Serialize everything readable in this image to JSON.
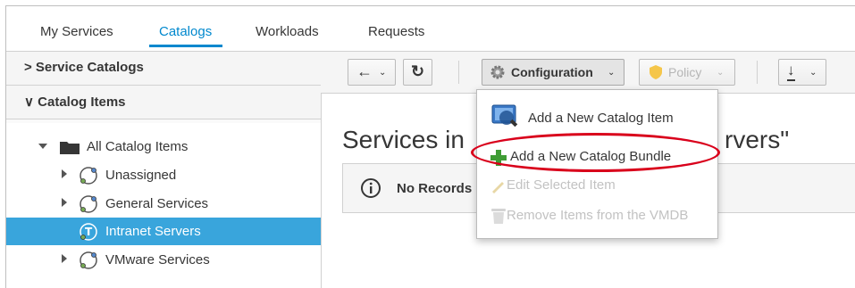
{
  "tabs": [
    {
      "label": "My Services"
    },
    {
      "label": "Catalogs"
    },
    {
      "label": "Workloads"
    },
    {
      "label": "Requests"
    }
  ],
  "sidebar": {
    "accordions": [
      {
        "label": "> Service Catalogs"
      },
      {
        "label": "∨ Catalog Items"
      }
    ],
    "tree": [
      {
        "label": "All Catalog Items"
      },
      {
        "label": "Unassigned"
      },
      {
        "label": "General Services"
      },
      {
        "label": "Intranet Servers"
      },
      {
        "label": "VMware Services"
      }
    ]
  },
  "toolbar": {
    "back_label": "←",
    "refresh_label": "↻",
    "configuration_label": "Configuration",
    "policy_label": "Policy",
    "download_label": "↓"
  },
  "main": {
    "heading_left": "Services in",
    "heading_right": "rvers\"",
    "no_records": "No Records"
  },
  "menu": {
    "items": [
      {
        "label": "Add a New Catalog Item"
      },
      {
        "label": "Add a New Catalog Bundle"
      },
      {
        "label": "Edit Selected Item"
      },
      {
        "label": "Remove Items from the VMDB"
      }
    ]
  },
  "colors": {
    "accent": "#0088ce",
    "selected": "#39a5dc",
    "highlight": "#d9001b"
  }
}
